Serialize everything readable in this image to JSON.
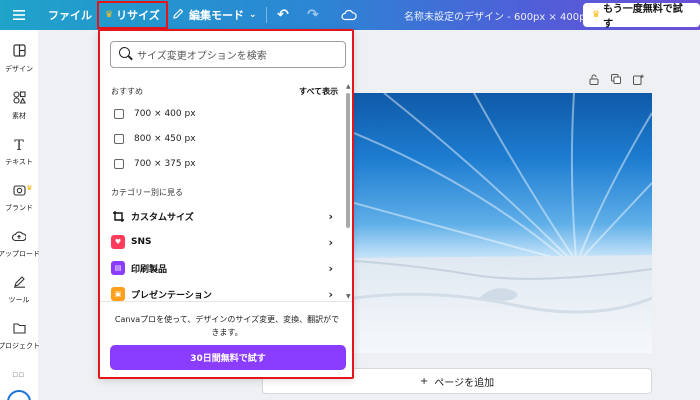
{
  "topbar": {
    "file_label": "ファイル",
    "resize_label": "リサイズ",
    "edit_mode_label": "編集モード",
    "document_title": "名称未設定のデザイン - 600px × 400px",
    "trial_label": "もう一度無料で試す"
  },
  "sidebar": {
    "items": [
      {
        "label": "デザイン",
        "icon": "layout-icon"
      },
      {
        "label": "素材",
        "icon": "elements-icon"
      },
      {
        "label": "テキスト",
        "icon": "text-icon"
      },
      {
        "label": "ブランド",
        "icon": "brand-icon"
      },
      {
        "label": "アップロード",
        "icon": "upload-icon"
      },
      {
        "label": "ツール",
        "icon": "tools-icon"
      },
      {
        "label": "プロジェクト",
        "icon": "folder-icon"
      }
    ]
  },
  "resize_panel": {
    "search_placeholder": "サイズ変更オプションを検索",
    "recommended_label": "おすすめ",
    "see_all_label": "すべて表示",
    "size_options": [
      "700 × 400 px",
      "800 × 450 px",
      "700 × 375 px"
    ],
    "category_heading": "カテゴリー別に見る",
    "categories": [
      {
        "label": "カスタムサイズ",
        "color": "#111111"
      },
      {
        "label": "SNS",
        "color": "#ff3b5c"
      },
      {
        "label": "印刷製品",
        "color": "#8b3dff"
      },
      {
        "label": "プレゼンテーション",
        "color": "#ff9f1a"
      }
    ],
    "promo_text": "Canvaプロを使って、デザインのサイズ変更、変換、翻訳ができます。",
    "cta_label": "30日間無料で試す"
  },
  "canvas": {
    "add_page_label": "ページを追加"
  },
  "colors": {
    "accent_purple": "#8b3dff",
    "highlight_red": "#e5161b"
  }
}
